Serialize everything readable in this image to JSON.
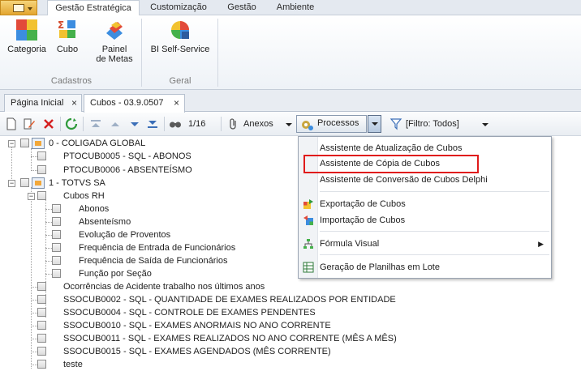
{
  "ribbon": {
    "tabs": [
      "Gestão Estratégica",
      "Customização",
      "Gestão",
      "Ambiente"
    ],
    "active_tab": "Gestão Estratégica",
    "groups": [
      {
        "label": "Cadastros",
        "buttons": [
          "Categoria",
          "Cubo",
          "Painel de Metas"
        ]
      },
      {
        "label": "Geral",
        "buttons": [
          "BI Self-Service"
        ]
      }
    ],
    "painel_line1": "Painel",
    "painel_line2": "de Metas"
  },
  "doc_tabs": [
    {
      "label": "Página Inicial",
      "active": false
    },
    {
      "label": "Cubos - 03.9.0507",
      "active": true
    }
  ],
  "toolbar": {
    "page_indicator": "1/16",
    "anexos_label": "Anexos",
    "processos_label": "Processos",
    "filter_label": "[Filtro: Todos]"
  },
  "tree": {
    "coligada_global": "0 - COLIGADA GLOBAL",
    "ptocub0005": "PTOCUB0005 - SQL - ABONOS",
    "ptocub0006": "PTOCUB0006 - ABSENTEÍSMO",
    "totvs": "1 - TOTVS SA",
    "cubos_rh": "Cubos RH",
    "abonos": "Abonos",
    "absenteismo": "Absenteísmo",
    "evolucao": "Evolução de Proventos",
    "freq_entrada": "Frequência de Entrada de Funcionários",
    "freq_saida": "Frequência de Saída de Funcionários",
    "funcao_secao": "Função por Seção",
    "ocorrencias": "Ocorrências de Acidente trabalho nos últimos anos",
    "ssocub0002": "SSOCUB0002 - SQL - QUANTIDADE DE EXAMES REALIZADOS POR ENTIDADE",
    "ssocub0004": "SSOCUB0004 - SQL - CONTROLE DE EXAMES PENDENTES",
    "ssocub0010": "SSOCUB0010 - SQL - EXAMES ANORMAIS NO ANO CORRENTE",
    "ssocub0011": "SSOCUB0011 - SQL - EXAMES REALIZADOS NO ANO CORRENTE (MÊS A MÊS)",
    "ssocub0015": "SSOCUB0015 - SQL - EXAMES AGENDADOS (MÊS CORRENTE)",
    "teste": "teste"
  },
  "menu": {
    "items": [
      "Assistente de Atualização de Cubos",
      "Assistente de Cópia de Cubos",
      "Assistente de Conversão de Cubos Delphi",
      "Exportação de Cubos",
      "Importação de Cubos",
      "Fórmula Visual",
      "Geração de Planilhas em Lote"
    ],
    "highlighted_item": "Assistente de Cópia de Cubos"
  },
  "colors": {
    "highlight_border": "#e01b1b",
    "ribbon_bg": "#e4e9f0",
    "app_button": "#e3a530"
  }
}
